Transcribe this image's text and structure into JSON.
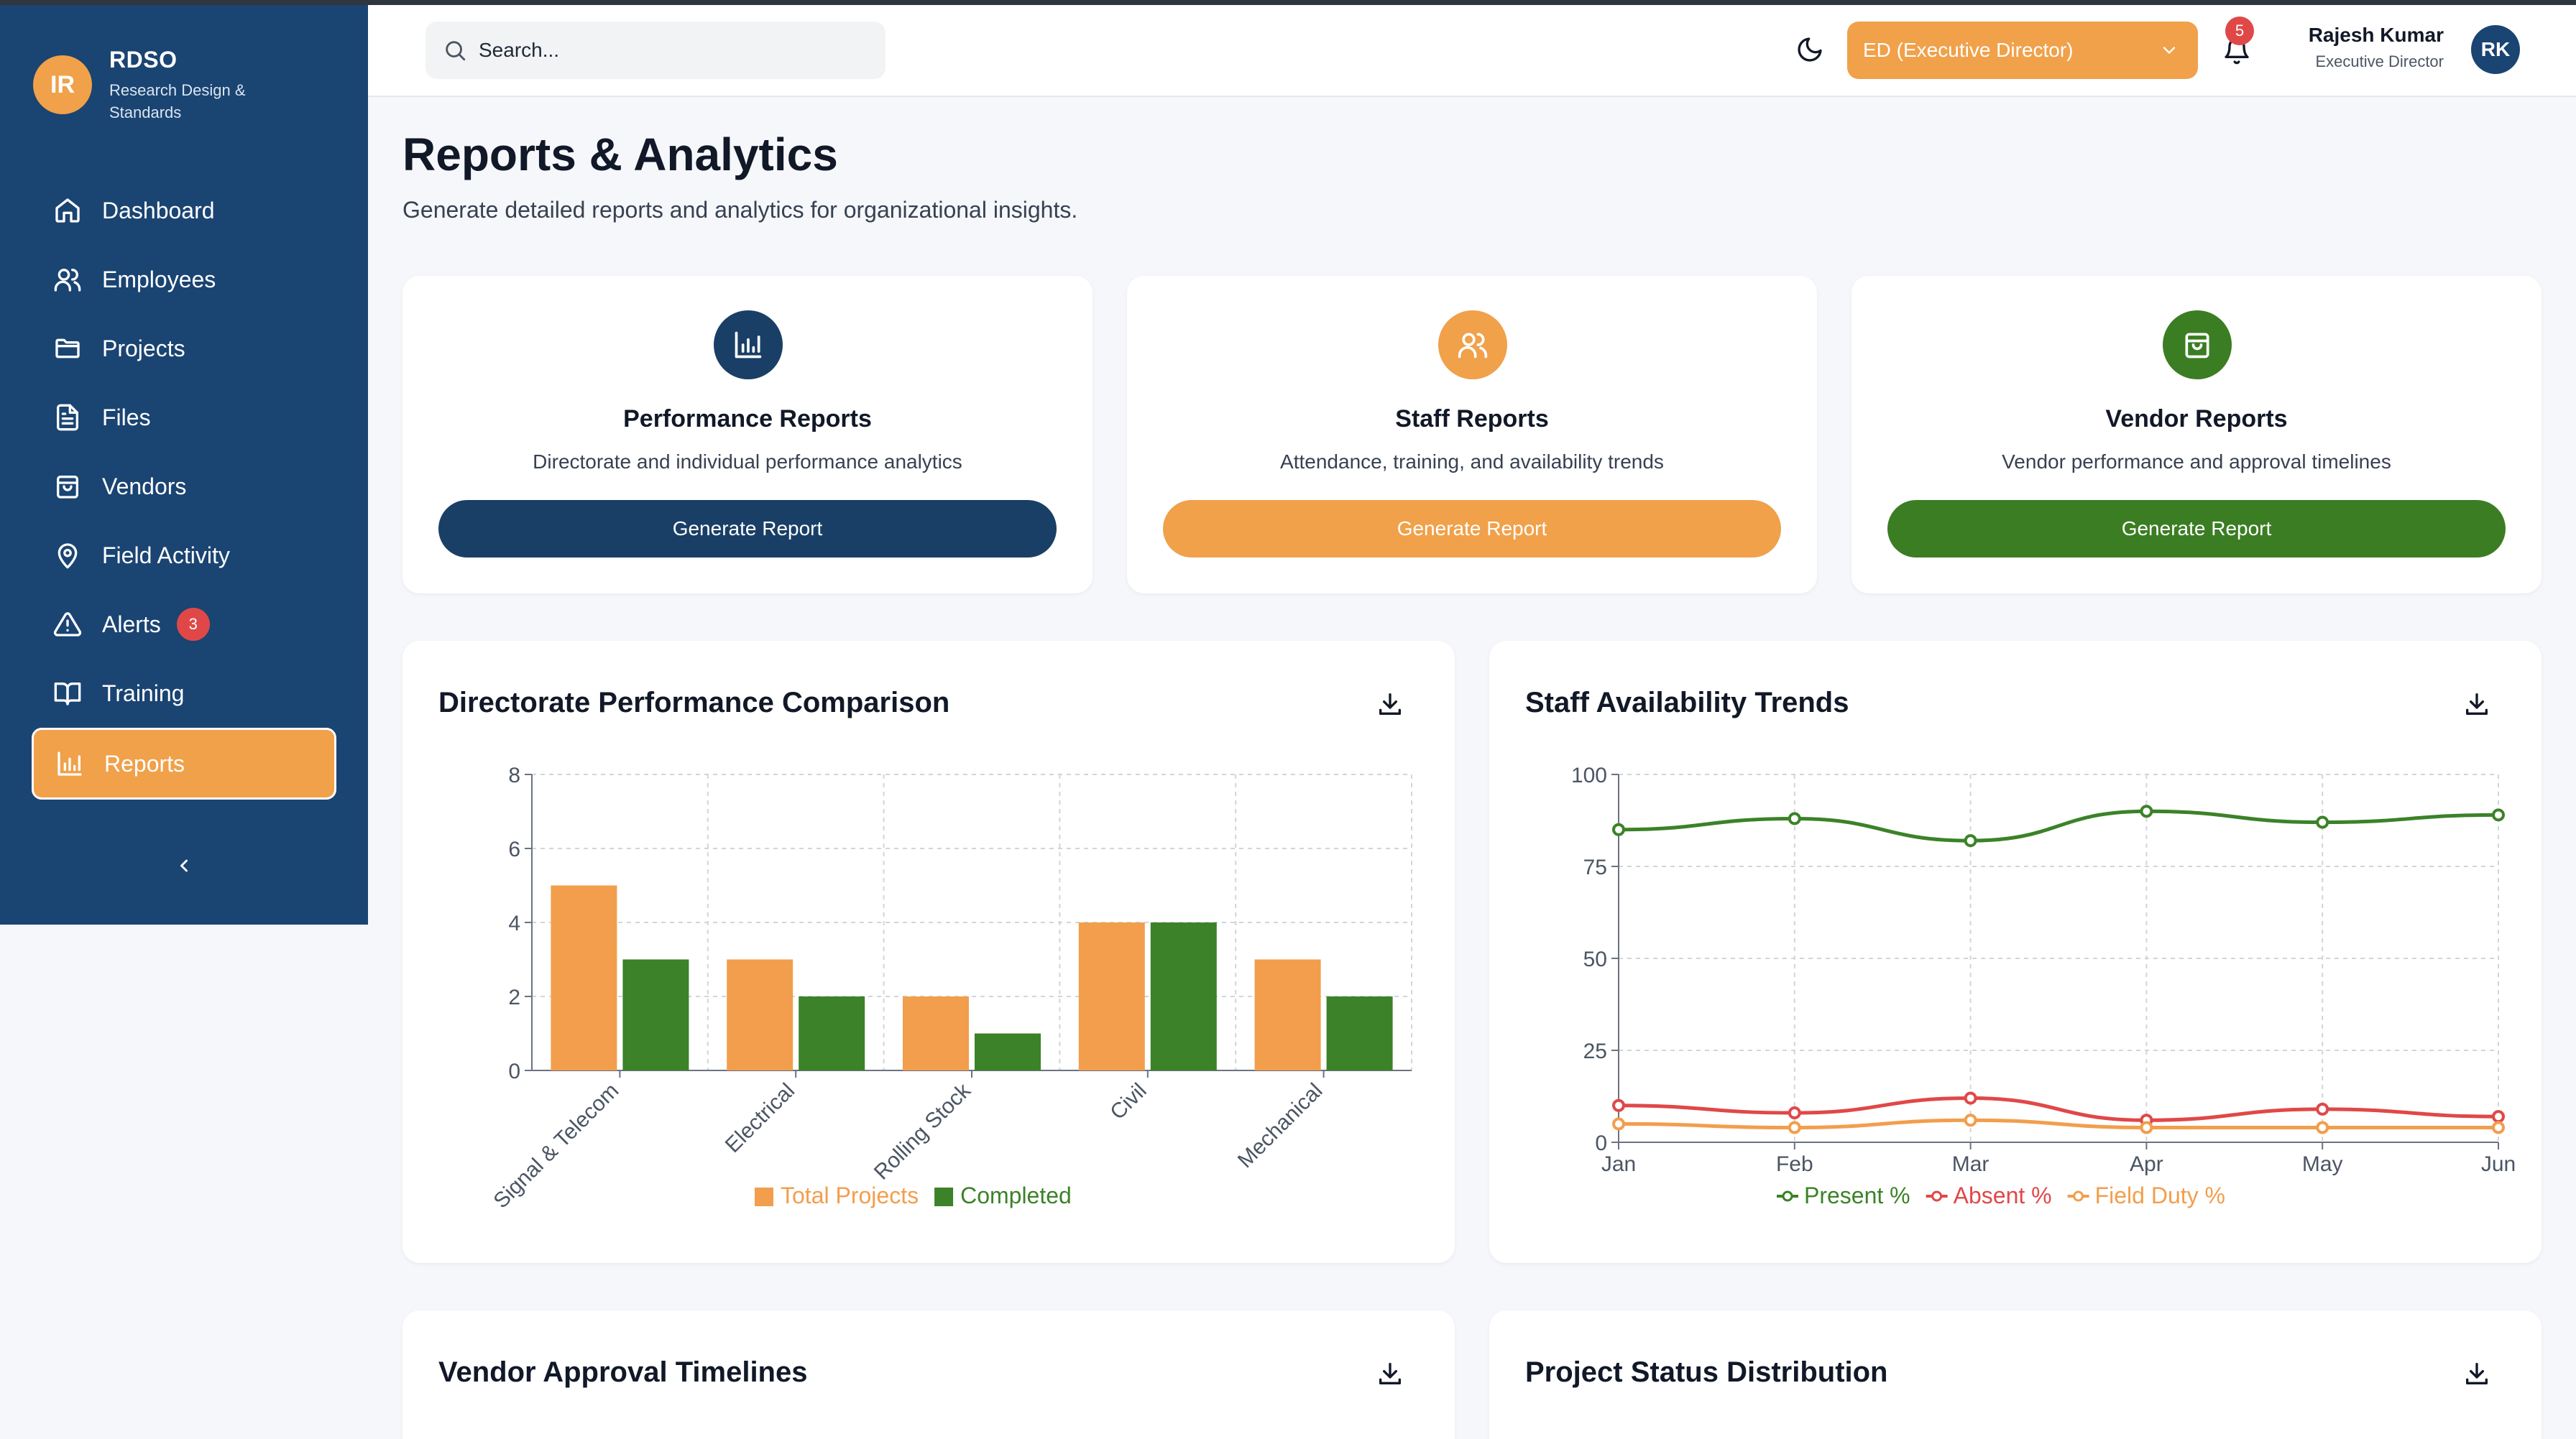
{
  "sidebar": {
    "brand_initials": "IR",
    "brand_name": "RDSO",
    "brand_sub": "Research Design & Standards",
    "items": [
      {
        "label": "Dashboard",
        "icon": "home-icon"
      },
      {
        "label": "Employees",
        "icon": "users-icon"
      },
      {
        "label": "Projects",
        "icon": "folder-icon"
      },
      {
        "label": "Files",
        "icon": "file-icon"
      },
      {
        "label": "Vendors",
        "icon": "bag-icon"
      },
      {
        "label": "Field Activity",
        "icon": "map-pin-icon"
      },
      {
        "label": "Alerts",
        "icon": "alert-triangle-icon",
        "badge": "3"
      },
      {
        "label": "Training",
        "icon": "book-icon"
      },
      {
        "label": "Reports",
        "icon": "bar-chart-icon",
        "active": true
      }
    ]
  },
  "header": {
    "search_placeholder": "Search...",
    "role_selected": "ED (Executive Director)",
    "notifications_count": "5",
    "user_name": "Rajesh Kumar",
    "user_role": "Executive Director",
    "user_initials": "RK"
  },
  "page": {
    "title": "Reports & Analytics",
    "subtitle": "Generate detailed reports and analytics for organizational insights."
  },
  "report_cards": [
    {
      "title": "Performance Reports",
      "desc": "Directorate and individual performance analytics",
      "button": "Generate Report",
      "color": "#1a3f66"
    },
    {
      "title": "Staff Reports",
      "desc": "Attendance, training, and availability trends",
      "button": "Generate Report",
      "color": "#f0a14a"
    },
    {
      "title": "Vendor Reports",
      "desc": "Vendor performance and approval timelines",
      "button": "Generate Report",
      "color": "#3b7d23"
    }
  ],
  "charts": {
    "perf_title": "Directorate Performance Comparison",
    "staff_title": "Staff Availability Trends",
    "vendor_title": "Vendor Approval Timelines",
    "status_title": "Project Status Distribution"
  },
  "chart_data": [
    {
      "type": "bar",
      "title": "Directorate Performance Comparison",
      "categories": [
        "Signal & Telecom",
        "Electrical",
        "Rolling Stock",
        "Civil",
        "Mechanical"
      ],
      "series": [
        {
          "name": "Total Projects",
          "values": [
            5,
            3,
            2,
            4,
            3
          ],
          "color": "#f29e4c"
        },
        {
          "name": "Completed",
          "values": [
            3,
            2,
            1,
            4,
            2
          ],
          "color": "#3b8228"
        }
      ],
      "ylim": [
        0,
        8
      ],
      "yticks": [
        0,
        2,
        4,
        6,
        8
      ],
      "grid": true,
      "legend": "bottom"
    },
    {
      "type": "line",
      "title": "Staff Availability Trends",
      "categories": [
        "Jan",
        "Feb",
        "Mar",
        "Apr",
        "May",
        "Jun"
      ],
      "series": [
        {
          "name": "Present %",
          "values": [
            85,
            88,
            82,
            90,
            87,
            89
          ],
          "color": "#3b8228"
        },
        {
          "name": "Absent %",
          "values": [
            10,
            8,
            12,
            6,
            9,
            7
          ],
          "color": "#e04848"
        },
        {
          "name": "Field Duty %",
          "values": [
            5,
            4,
            6,
            4,
            4,
            4
          ],
          "color": "#f29e4c"
        }
      ],
      "ylim": [
        0,
        100
      ],
      "yticks": [
        0,
        25,
        50,
        75,
        100
      ],
      "grid": true,
      "legend": "bottom"
    }
  ]
}
